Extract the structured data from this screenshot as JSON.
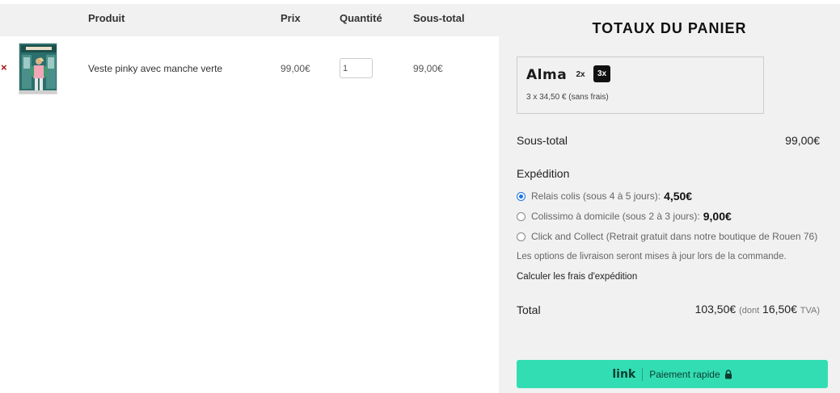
{
  "cart": {
    "headers": {
      "product": "Produit",
      "price": "Prix",
      "quantity": "Quantité",
      "subtotal": "Sous-total"
    },
    "items": [
      {
        "remove_label": "×",
        "name": "Veste pinky avec manche verte",
        "price": "99,00€",
        "quantity": "1",
        "subtotal": "99,00€"
      }
    ]
  },
  "totals": {
    "title": "TOTAUX DU PANIER",
    "alma": {
      "logo": "Alma",
      "option_2x": "2x",
      "option_3x": "3x",
      "selected": "3x",
      "detail": "3 x 34,50 € (sans frais)"
    },
    "subtotal_label": "Sous-total",
    "subtotal_value": "99,00€",
    "shipping": {
      "title": "Expédition",
      "options": [
        {
          "label": "Relais colis (sous 4 à 5 jours):",
          "price": "4,50€",
          "selected": true
        },
        {
          "label": "Colissimo à domicile (sous 2 à 3 jours):",
          "price": "9,00€",
          "selected": false
        },
        {
          "label": "Click and Collect (Retrait gratuit dans notre boutique de Rouen 76)",
          "price": "",
          "selected": false
        }
      ],
      "note": "Les options de livraison seront mises à jour lors de la commande.",
      "calculate_link": "Calculer les frais d'expédition"
    },
    "total_label": "Total",
    "total_value": "103,50€",
    "total_dont": "(dont",
    "total_tax_value": "16,50€",
    "total_tax_label": "TVA)",
    "pay_button": {
      "logo": "link",
      "label": "Paiement rapide"
    }
  },
  "colors": {
    "accent": "#33ddb3",
    "remove": "#a3141a",
    "radio_selected": "#1a73e8",
    "panel_bg": "#f1f1f1"
  }
}
